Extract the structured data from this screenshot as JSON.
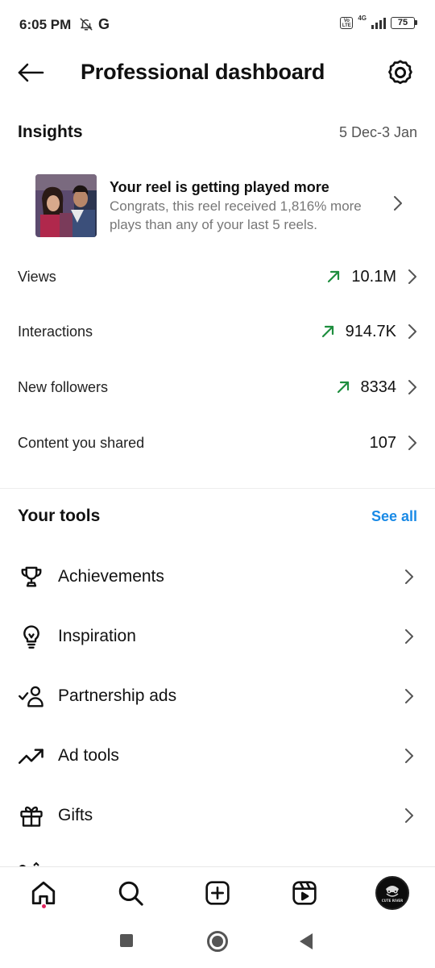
{
  "status_bar": {
    "time": "6:05 PM",
    "carrier_glyph": "G",
    "network": "4G",
    "volte": "Vo LTE",
    "battery": "75",
    "icons": [
      "bell-off-icon",
      "signal-icon",
      "battery-icon"
    ]
  },
  "header": {
    "title": "Professional dashboard",
    "back_icon": "arrow-left-icon",
    "settings_icon": "settings-gear-icon"
  },
  "insights": {
    "title": "Insights",
    "date_range": "5 Dec-3 Jan",
    "reel_card": {
      "title": "Your reel is getting played more",
      "description": "Congrats, this reel received 1,816% more plays than any of your last 5 reels."
    },
    "metrics": [
      {
        "label": "Views",
        "value": "10.1M",
        "trend": "up"
      },
      {
        "label": "Interactions",
        "value": "914.7K",
        "trend": "up"
      },
      {
        "label": "New followers",
        "value": "8334",
        "trend": "up"
      },
      {
        "label": "Content you shared",
        "value": "107",
        "trend": "none"
      }
    ],
    "trend_color": "#1e8e3e"
  },
  "tools": {
    "title": "Your tools",
    "see_all": "See all",
    "accent_color": "#1a8ae6",
    "items": [
      {
        "label": "Achievements",
        "icon": "trophy-icon"
      },
      {
        "label": "Inspiration",
        "icon": "lightbulb-icon"
      },
      {
        "label": "Partnership ads",
        "icon": "partnership-icon"
      },
      {
        "label": "Ad tools",
        "icon": "trending-up-icon"
      },
      {
        "label": "Gifts",
        "icon": "gift-icon"
      }
    ]
  },
  "bottom_nav": {
    "items": [
      "home-icon",
      "search-icon",
      "create-icon",
      "reels-icon",
      "profile-avatar"
    ],
    "avatar_text": "CUTE RIVER"
  },
  "system_nav": {
    "items": [
      "recents-square",
      "home-circle",
      "back-triangle"
    ]
  }
}
